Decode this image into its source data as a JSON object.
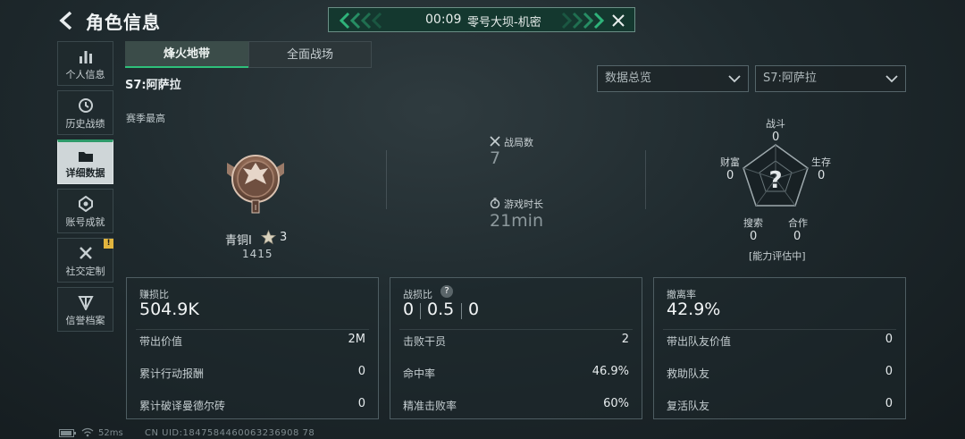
{
  "header": {
    "title": "角色信息",
    "match_time": "00:09",
    "match_name": "零号大坝-机密"
  },
  "sidebar": {
    "items": [
      {
        "label": "个人信息",
        "icon": "bar-chart-icon"
      },
      {
        "label": "历史战绩",
        "icon": "history-icon"
      },
      {
        "label": "详细数据",
        "icon": "folder-icon",
        "active": true
      },
      {
        "label": "账号成就",
        "icon": "achievement-icon"
      },
      {
        "label": "社交定制",
        "icon": "tools-icon",
        "badge": "!"
      },
      {
        "label": "信誉档案",
        "icon": "credit-shield-icon"
      }
    ]
  },
  "tabs": {
    "fire": "烽火地带",
    "all": "全面战场"
  },
  "season_title": "S7:阿萨拉",
  "dropdowns": {
    "overview": "数据总览",
    "season": "S7:阿萨拉"
  },
  "rank": {
    "section_label": "赛季最高",
    "name": "青铜I",
    "stars": "3",
    "score": "1415"
  },
  "summary": {
    "matches_label": "战局数",
    "matches_value": "7",
    "playtime_label": "游戏时长",
    "playtime_value": "21min"
  },
  "radar": {
    "combat_label": "战斗",
    "combat_value": "0",
    "survival_label": "生存",
    "survival_value": "0",
    "teamwork_label": "合作",
    "teamwork_value": "0",
    "search_label": "搜索",
    "search_value": "0",
    "wealth_label": "财富",
    "wealth_value": "0",
    "center_symbol": "?",
    "status": "[能力评估中]"
  },
  "cards": {
    "profit": {
      "title": "赚损比",
      "value": "504.9K",
      "rows": [
        {
          "label": "带出价值",
          "value": "2M"
        },
        {
          "label": "累计行动报酬",
          "value": "0"
        },
        {
          "label": "累计破译曼德尔砖",
          "value": "0"
        }
      ]
    },
    "kd": {
      "title": "战损比",
      "help": "?",
      "v1": "0",
      "v2": "0.5",
      "v3": "0",
      "rows": [
        {
          "label": "击败干员",
          "value": "2"
        },
        {
          "label": "命中率",
          "value": "46.9%"
        },
        {
          "label": "精准击败率",
          "value": "60%"
        }
      ]
    },
    "extract": {
      "title": "撤离率",
      "value": "42.9%",
      "rows": [
        {
          "label": "带出队友价值",
          "value": "0"
        },
        {
          "label": "救助队友",
          "value": "0"
        },
        {
          "label": "复活队友",
          "value": "0"
        }
      ]
    }
  },
  "footer": {
    "ping": "52ms",
    "uid": "CN UID:1847584460063236908 78"
  }
}
